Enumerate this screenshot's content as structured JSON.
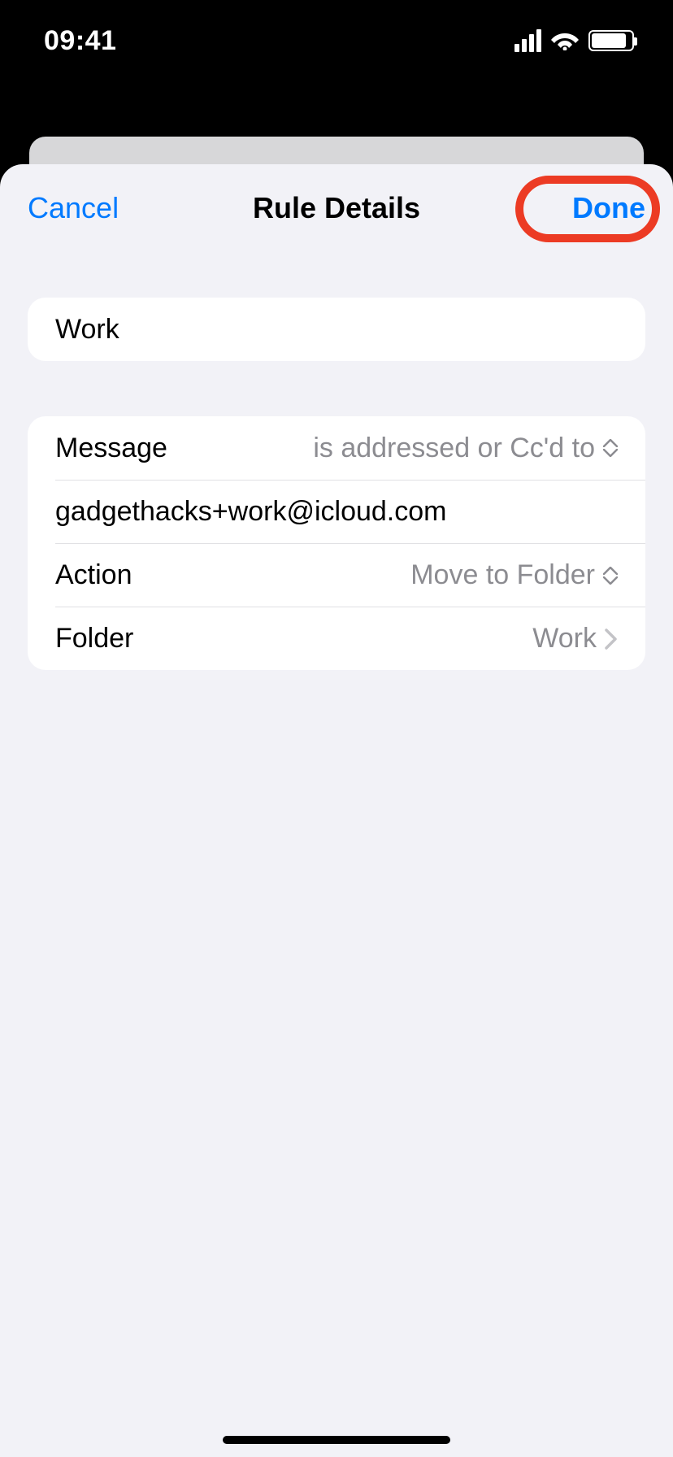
{
  "statusbar": {
    "time": "09:41"
  },
  "nav": {
    "cancel_label": "Cancel",
    "title": "Rule Details",
    "done_label": "Done"
  },
  "rule": {
    "name": "Work",
    "message_label": "Message",
    "message_condition": "is addressed or Cc'd to",
    "address": "gadgethacks+work@icloud.com",
    "action_label": "Action",
    "action_value": "Move to Folder",
    "folder_label": "Folder",
    "folder_value": "Work"
  }
}
